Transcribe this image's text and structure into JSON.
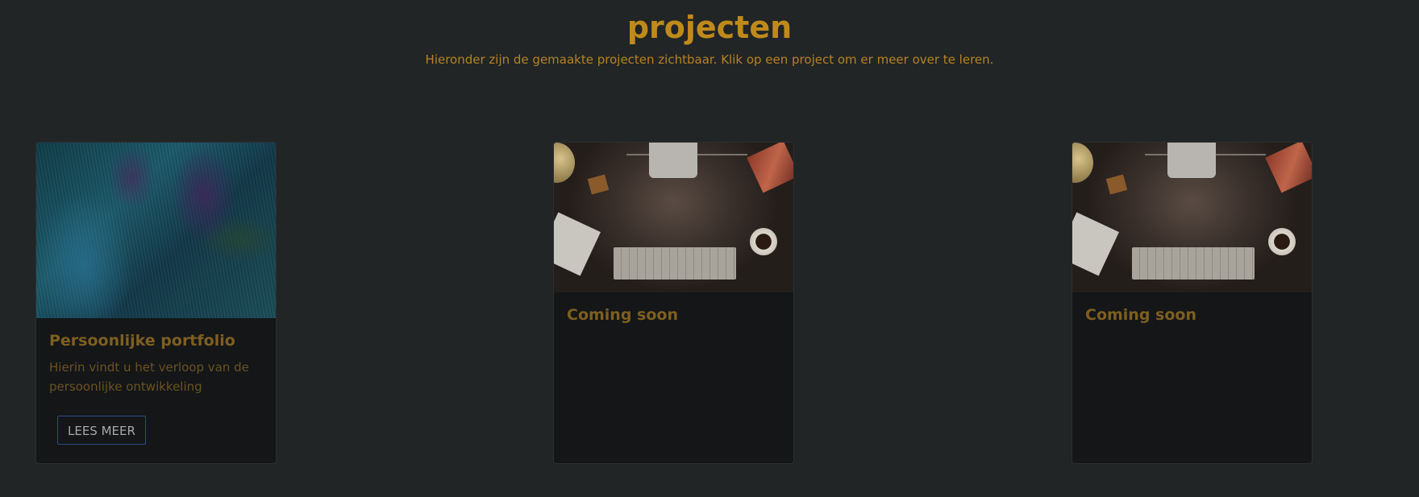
{
  "header": {
    "title": "projecten",
    "subtitle": "Hieronder zijn de gemaakte projecten zichtbaar. Klik op een project om er meer over te leren."
  },
  "projects": [
    {
      "title": "Persoonlijke portfolio",
      "description": "Hierin vindt u het verloop van de persoonlijke ontwikkeling",
      "button_label": "LEES MEER"
    },
    {
      "title": "Coming soon"
    },
    {
      "title": "Coming soon"
    }
  ],
  "colors": {
    "background": "#212526",
    "accent": "#c08a1b",
    "card": "#141618",
    "button_border": "#2d4c86"
  }
}
